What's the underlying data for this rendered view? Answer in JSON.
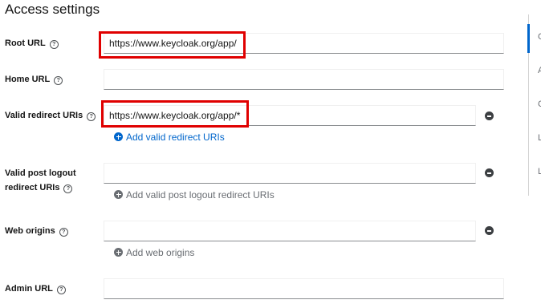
{
  "section": {
    "title": "Access settings"
  },
  "fields": {
    "root_url": {
      "label": "Root URL",
      "value": "https://www.keycloak.org/app/"
    },
    "home_url": {
      "label": "Home URL",
      "value": ""
    },
    "valid_redirect_uris": {
      "label": "Valid redirect URIs",
      "value": "https://www.keycloak.org/app/*",
      "add_label": "Add valid redirect URIs"
    },
    "valid_post_logout": {
      "label_line1": "Valid post logout",
      "label_line2": "redirect URIs",
      "value": "",
      "add_label": "Add valid post logout redirect URIs"
    },
    "web_origins": {
      "label": "Web origins",
      "value": "",
      "add_label": "Add web origins"
    },
    "admin_url": {
      "label": "Admin URL",
      "value": ""
    }
  },
  "icons": {
    "help": "help-circle-icon",
    "remove": "minus-circle-icon",
    "add": "plus-circle-icon"
  },
  "jump_links": [
    "G",
    "A",
    "C",
    "L",
    "L"
  ],
  "colors": {
    "highlight": "#e00000",
    "link": "#0066cc",
    "active_jump": "#0066cc"
  }
}
